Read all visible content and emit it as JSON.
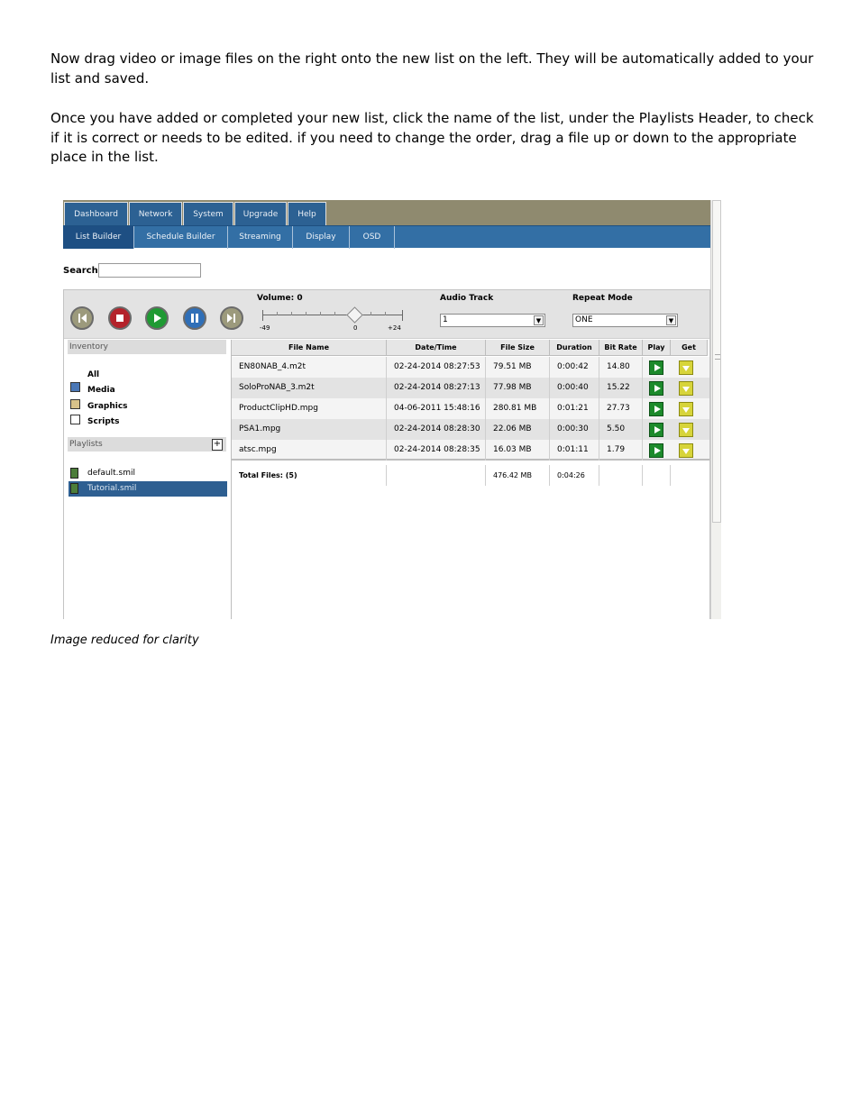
{
  "instructions": {
    "paragraph1": "Now drag video or image files on the right onto the new list on the left.  They will be automatically added to your list and saved.",
    "paragraph2": "Once you have added or completed your new list, click the name of the list, under the Playlists Header, to check if it is correct or needs to be edited.  if you need to change the order, drag a file up or down to the appropriate place in the list.",
    "caption": "Image reduced for clarity"
  },
  "app": {
    "top_tabs": [
      "Dashboard",
      "Network",
      "System",
      "Upgrade",
      "Help"
    ],
    "sub_tabs": [
      "List Builder",
      "Schedule Builder",
      "Streaming",
      "Display",
      "OSD"
    ],
    "search_label": "Search",
    "controls": {
      "volume_label": "Volume: 0",
      "slider_min": "-49",
      "slider_mid": "0",
      "slider_max": "+24",
      "audio_track_label": "Audio Track",
      "audio_track_value": "1",
      "repeat_mode_label": "Repeat Mode",
      "repeat_mode_value": "ONE",
      "button_icons": [
        "rewind-icon",
        "stop-icon",
        "play-icon",
        "pause-icon",
        "forward-icon"
      ]
    },
    "inventory": {
      "header": "Inventory",
      "items": [
        "All",
        "Media",
        "Graphics",
        "Scripts"
      ]
    },
    "playlists": {
      "header": "Playlists",
      "items": [
        "default.smil",
        "Tutorial.smil"
      ],
      "selected": "Tutorial.smil"
    },
    "table": {
      "columns": [
        "File Name",
        "Date/Time",
        "File Size",
        "Duration",
        "Bit Rate",
        "Play",
        "Get"
      ],
      "rows": [
        {
          "name": "EN80NAB_4.m2t",
          "datetime": "02-24-2014   08:27:53",
          "size": "79.51 MB",
          "duration": "0:00:42",
          "bitrate": "14.80"
        },
        {
          "name": "SoloProNAB_3.m2t",
          "datetime": "02-24-2014   08:27:13",
          "size": "77.98 MB",
          "duration": "0:00:40",
          "bitrate": "15.22"
        },
        {
          "name": "ProductClipHD.mpg",
          "datetime": "04-06-2011   15:48:16",
          "size": "280.81 MB",
          "duration": "0:01:21",
          "bitrate": "27.73"
        },
        {
          "name": "PSA1.mpg",
          "datetime": "02-24-2014   08:28:30",
          "size": "22.06 MB",
          "duration": "0:00:30",
          "bitrate": "5.50"
        },
        {
          "name": "atsc.mpg",
          "datetime": "02-24-2014   08:28:35",
          "size": "16.03 MB",
          "duration": "0:01:11",
          "bitrate": "1.79"
        }
      ],
      "totals": {
        "label": "Total Files: (5)",
        "size": "476.42 MB",
        "duration": "0:04:26"
      }
    }
  }
}
